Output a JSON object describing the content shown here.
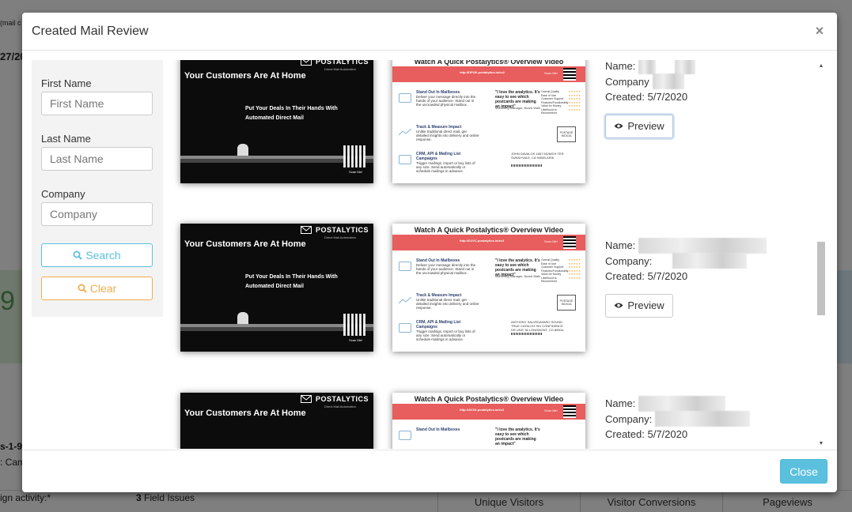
{
  "background": {
    "fragments": [
      "(mail c",
      "27/20",
      "9 /",
      "s-1-9",
      ": Cam",
      "ign activity:*",
      "3",
      "Field Issues"
    ],
    "tabs": [
      "Unique Visitors",
      "Visitor Conversions",
      "Pageviews"
    ]
  },
  "modal": {
    "title": "Created Mail Review",
    "close_glyph": "×",
    "footer_close_label": "Close"
  },
  "filter": {
    "first_name_label": "First Name",
    "first_name_placeholder": "First Name",
    "last_name_label": "Last Name",
    "last_name_placeholder": "Last Name",
    "company_label": "Company",
    "company_placeholder": "Company",
    "search_label": "Search",
    "clear_label": "Clear"
  },
  "postcard_front": {
    "brand": "POSTALYTICS",
    "brand_sub": "Direct Mail Automation",
    "headline": "Your Customers Are At Home",
    "subline_1": "Put Your Deals In Their Hands With",
    "subline_2": "Automated Direct Mail",
    "scan": "Scan Me!"
  },
  "postcard_back": {
    "title": "Watch A Quick Postalytics® Overview Video",
    "scan": "Scan Me!",
    "section1_title": "Stand Out In Mailboxes",
    "section1_text": "Deliver your message directly into the hands of your audience. Stand out in the uncrowded physical mailbox.",
    "section2_title": "Track & Measure Impact",
    "section2_text": "Unlike traditional direct mail, get detailed insights into delivery and online response.",
    "section3_title": "CRM, API & Mailing List Campaigns",
    "section3_text": "Trigger mailings, import or buy lists of any size. Send automatically or schedule mailings in advance.",
    "quote": "\"I love the analytics. It's easy to see which postcards are making an impact\"",
    "quote_by": "Marketing Manager, Board Walk",
    "ratings": [
      "Overall Quality",
      "Ease of Use",
      "Customer Support",
      "Features/Functionality",
      "Value for Money",
      "Likelihood to Recommend"
    ],
    "stars": "★★★★★",
    "postage": "POSTAGE INDICIA"
  },
  "items": [
    {
      "url": "http://DPUK.postalytics.io/ec2",
      "name_label": "Name:",
      "company_label": "Company",
      "created": "Created: 5/7/2020",
      "preview_label": "Preview",
      "recipient": "JOHN DAVALOS 1667 MUNICH TER SUNNYVALE, CA 94089-4306"
    },
    {
      "url": "http://DJVC.postalytics.io/ec2",
      "name_label": "Name:",
      "company_label": "Company:",
      "created": "Created: 5/7/2020",
      "preview_label": "Preview",
      "recipient": "ANTHONY SALVEDAVARO SOUND TRUE CATALOG 901 CONFIDENCE DR UNIT 36 LONGMONT, CO 80504-4451"
    },
    {
      "url": "http://AVZA.postalytics.io/ec2",
      "name_label": "Name:",
      "company_label": "Company:",
      "created": "Created: 5/7/2020",
      "preview_label": "Preview",
      "recipient": ""
    }
  ],
  "colors": {
    "info": "#5bc0de",
    "warning": "#f0ad4e",
    "band": "#e85d5d"
  }
}
